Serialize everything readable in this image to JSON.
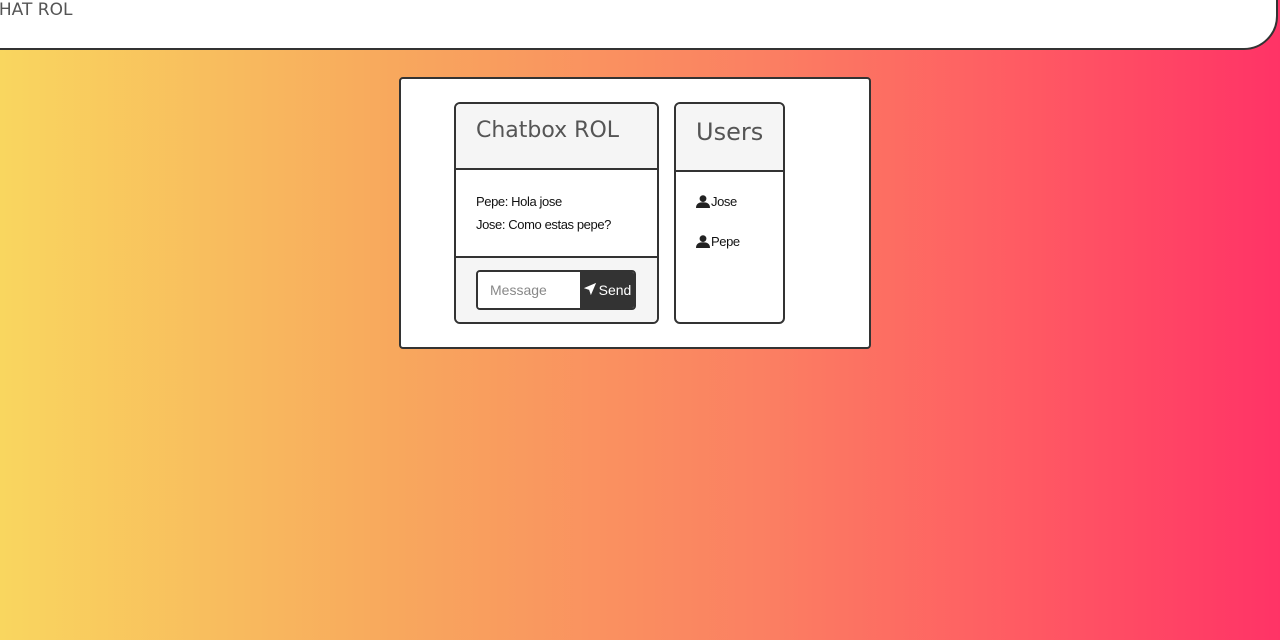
{
  "navbar": {
    "brand": "CHAT ROL"
  },
  "chat": {
    "title": "Chatbox ROL",
    "messages": [
      {
        "text": "Pepe: Hola jose"
      },
      {
        "text": "Jose: Como estas pepe?"
      }
    ],
    "composer": {
      "placeholder": "Message",
      "value": "",
      "send_label": "Send",
      "send_icon": "paper-plane-icon"
    }
  },
  "users": {
    "title": "Users",
    "items": [
      {
        "name": "Jose",
        "icon": "user-icon"
      },
      {
        "name": "Pepe",
        "icon": "user-icon"
      }
    ]
  },
  "colors": {
    "gradient_start": "#f9d65f",
    "gradient_end": "#ff3366",
    "dark": "#333333",
    "header_bg": "#f5f5f5"
  }
}
